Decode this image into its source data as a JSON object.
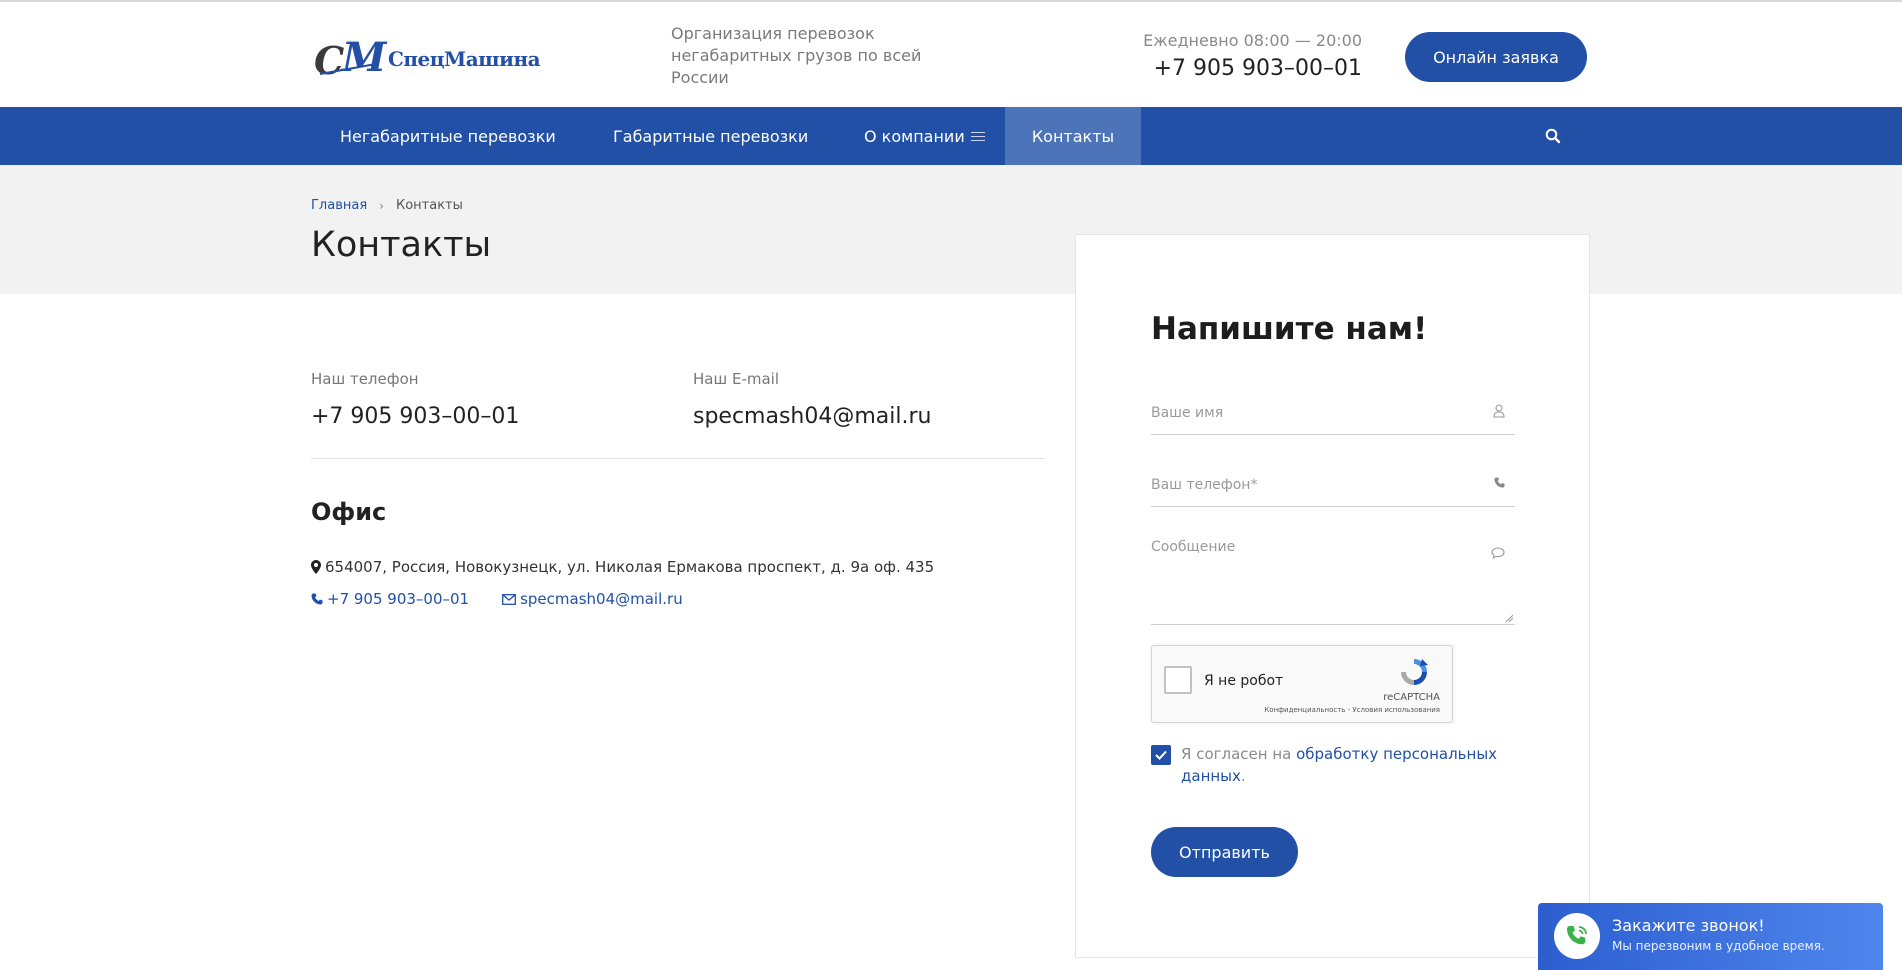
{
  "header": {
    "logo_text": "СпецМашина",
    "logo_mark": "СМ",
    "tagline": "Организация перевозок негабаритных грузов по всей России",
    "hours": "Ежедневно 08:00 — 20:00",
    "phone": "+7 905 903–00–01",
    "online_button": "Онлайн заявка"
  },
  "nav": {
    "items": [
      {
        "label": "Негабаритные перевозки"
      },
      {
        "label": "Габаритные перевозки"
      },
      {
        "label": "О компании"
      },
      {
        "label": "Контакты"
      }
    ],
    "active": "Контакты"
  },
  "breadcrumb": {
    "home": "Главная",
    "current": "Контакты"
  },
  "page_title": "Контакты",
  "contacts": {
    "phone_label": "Наш телефон",
    "phone_value": "+7 905 903–00–01",
    "email_label": "Наш E-mail",
    "email_value": "specmash04@mail.ru"
  },
  "office": {
    "title": "Офис",
    "address": "654007, Россия, Новокузнецк, ул. Николая Ермакова проспект, д. 9а оф. 435",
    "phone": "+7 905 903–00–01",
    "email": "specmash04@mail.ru"
  },
  "form": {
    "title": "Напишите нам!",
    "name_placeholder": "Ваше имя",
    "phone_placeholder": "Ваш телефон*",
    "message_placeholder": "Сообщение",
    "recaptcha_label": "Я не робот",
    "recaptcha_brand": "reCAPTCHA",
    "recaptcha_terms": "Конфиденциальность - Условия использования",
    "consent_prefix": "Я согласен на ",
    "consent_link": "обработку персональных данных",
    "consent_suffix": ".",
    "consent_checked": true,
    "submit": "Отправить"
  },
  "callback": {
    "title": "Закажите звонок!",
    "subtitle": "Мы перезвоним в удобное время."
  },
  "colors": {
    "brand_blue": "#2150a6",
    "nav_active": "#4d74b9",
    "band_grey": "#f2f2f2"
  },
  "icons": {
    "search": "search-icon",
    "user": "user-icon",
    "phone": "phone-icon",
    "message": "chat-bubble-icon",
    "map_marker": "map-marker-icon",
    "envelope": "envelope-icon"
  }
}
